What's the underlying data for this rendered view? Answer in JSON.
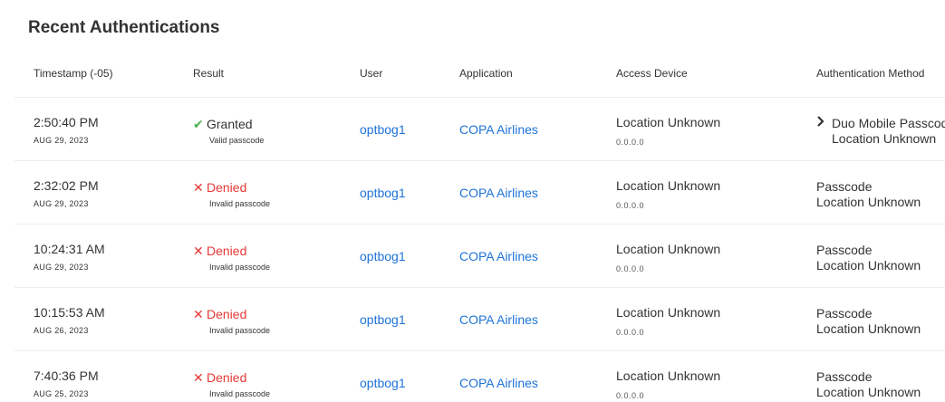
{
  "page": {
    "title": "Recent Authentications"
  },
  "table": {
    "columns": {
      "timestamp": "Timestamp (-05)",
      "result": "Result",
      "user": "User",
      "application": "Application",
      "access_device": "Access Device",
      "auth_method": "Authentication Method"
    },
    "rows": [
      {
        "time": "2:50:40 PM",
        "date": "AUG 29, 2023",
        "result_status": "granted",
        "result_icon": "✔",
        "result_label": "Granted",
        "result_reason": "Valid passcode",
        "user": "optbog1",
        "application": "COPA Airlines",
        "device_location": "Location Unknown",
        "device_ip": "0.0.0.0",
        "method": "Duo Mobile Passcode",
        "method_location": "Location Unknown",
        "expandable": true
      },
      {
        "time": "2:32:02 PM",
        "date": "AUG 29, 2023",
        "result_status": "denied",
        "result_icon": "✕",
        "result_label": "Denied",
        "result_reason": "Invalid passcode",
        "user": "optbog1",
        "application": "COPA Airlines",
        "device_location": "Location Unknown",
        "device_ip": "0.0.0.0",
        "method": "Passcode",
        "method_location": "Location Unknown",
        "expandable": false
      },
      {
        "time": "10:24:31 AM",
        "date": "AUG 29, 2023",
        "result_status": "denied",
        "result_icon": "✕",
        "result_label": "Denied",
        "result_reason": "Invalid passcode",
        "user": "optbog1",
        "application": "COPA Airlines",
        "device_location": "Location Unknown",
        "device_ip": "0.0.0.0",
        "method": "Passcode",
        "method_location": "Location Unknown",
        "expandable": false
      },
      {
        "time": "10:15:53 AM",
        "date": "AUG 26, 2023",
        "result_status": "denied",
        "result_icon": "✕",
        "result_label": "Denied",
        "result_reason": "Invalid passcode",
        "user": "optbog1",
        "application": "COPA Airlines",
        "device_location": "Location Unknown",
        "device_ip": "0.0.0.0",
        "method": "Passcode",
        "method_location": "Location Unknown",
        "expandable": false
      },
      {
        "time": "7:40:36 PM",
        "date": "AUG 25, 2023",
        "result_status": "denied",
        "result_icon": "✕",
        "result_label": "Denied",
        "result_reason": "Invalid passcode",
        "user": "optbog1",
        "application": "COPA Airlines",
        "device_location": "Location Unknown",
        "device_ip": "0.0.0.0",
        "method": "Passcode",
        "method_location": "Location Unknown",
        "expandable": false
      }
    ]
  },
  "colors": {
    "granted": "#4caf50",
    "denied": "#e53935",
    "link": "#1e73d8",
    "text": "#333333",
    "divider": "#eeeeee"
  },
  "icons": {
    "granted": "check-icon",
    "denied": "x-icon",
    "expand": "chevron-right-icon"
  }
}
